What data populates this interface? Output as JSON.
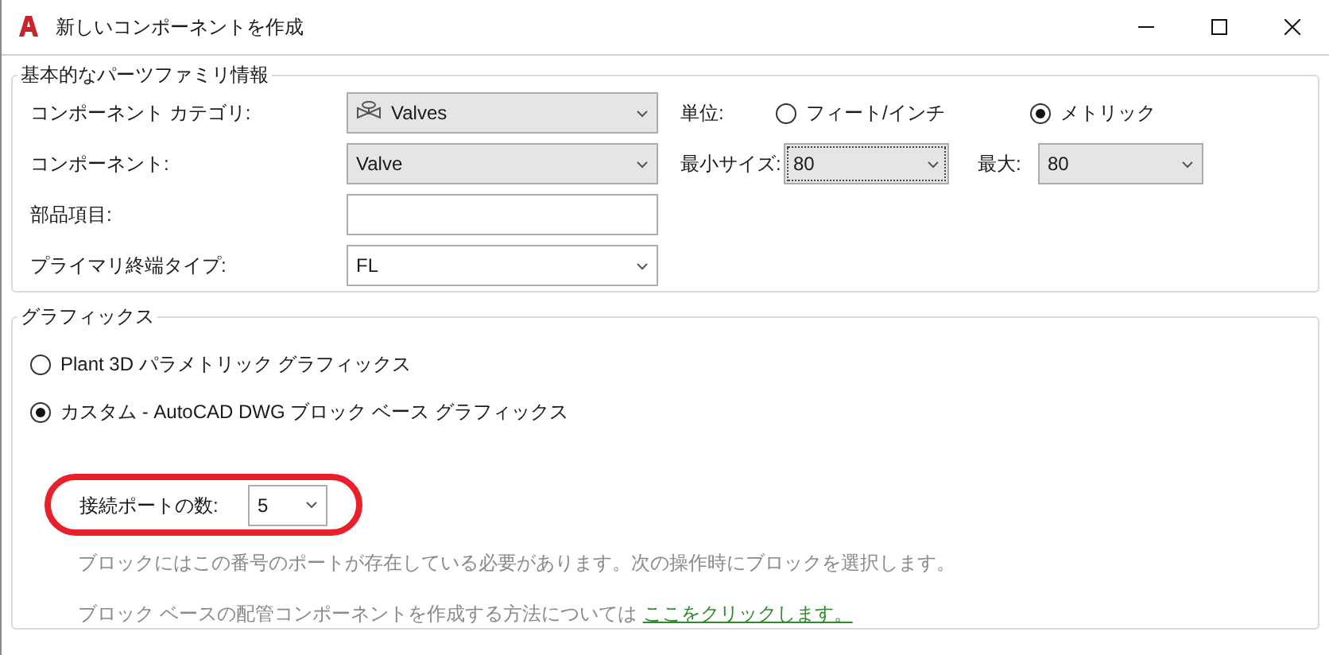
{
  "window": {
    "title": "新しいコンポーネントを作成"
  },
  "part_family": {
    "title": "基本的なパーツファミリ情報",
    "fields": [
      {
        "kind": "dropdown",
        "label": "コンポーネント カテゴリ:",
        "value": "Valves"
      },
      {
        "kind": "dropdown",
        "label": "コンポーネント:",
        "value": "Valve"
      },
      {
        "kind": "text",
        "label": "部品項目:"
      },
      {
        "kind": "combo",
        "label": "プライマリ終端タイプ:",
        "value": "FL"
      }
    ],
    "units": {
      "label": "単位:",
      "options": [
        {
          "label": "フィート/インチ",
          "selected": false
        },
        {
          "label": "メトリック",
          "selected": true
        }
      ]
    },
    "min_size": {
      "label": "最小サイズ:",
      "value": "80",
      "focused": true
    },
    "max_size": {
      "label": "最大:",
      "value": "80",
      "focused": false
    }
  },
  "graphics": {
    "title": "グラフィックス",
    "options": [
      {
        "label": "Plant 3D パラメトリック グラフィックス",
        "selected": false
      },
      {
        "label": "カスタム - AutoCAD DWG ブロック ベース グラフィックス",
        "selected": true
      }
    ],
    "port_count": {
      "label": "接続ポートの数:",
      "value": "5",
      "highlighted": true
    },
    "notes": [
      {
        "text": "ブロックにはこの番号のポートが存在している必要があります。次の操作時にブロックを選択します。"
      },
      {
        "text": "ブロック ベースの配管コンポーネントを作成する方法については",
        "link": "ここをクリックします。"
      }
    ]
  }
}
